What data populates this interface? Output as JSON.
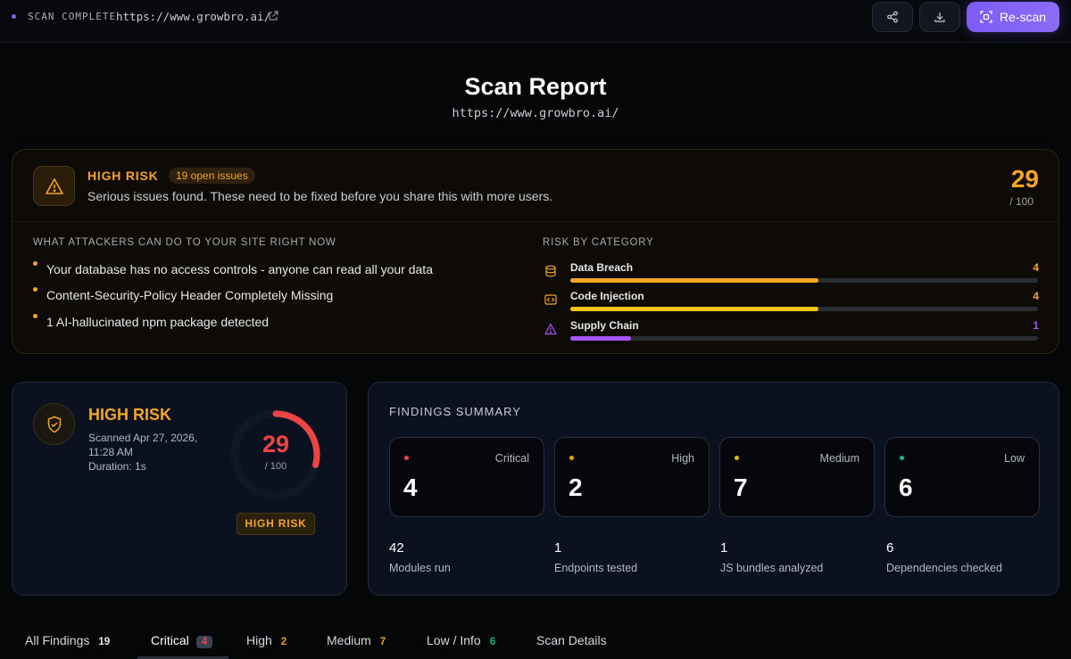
{
  "topbar": {
    "status": "SCAN COMPLETE",
    "url": "https://www.growbro.ai/",
    "share_icon": "share-icon",
    "download_icon": "download-icon",
    "rescan_label": "Re-scan",
    "accent": "#7c5cf5"
  },
  "header": {
    "title": "Scan Report",
    "url": "https://www.growbro.ai/"
  },
  "banner": {
    "risk_label": "HIGH RISK",
    "issues_pill": "19 open issues",
    "description": "Serious issues found. These need to be fixed before you share this with more users.",
    "score": "29",
    "score_max": "/ 100",
    "attackers_heading": "WHAT ATTACKERS CAN DO TO YOUR SITE RIGHT NOW",
    "attacks": [
      "Your database has no access controls - anyone can read all your data",
      "Content-Security-Policy Header Completely Missing",
      "1 AI-hallucinated npm package detected"
    ],
    "category_heading": "RISK BY CATEGORY",
    "categories": [
      {
        "label": "Data Breach",
        "count": "4",
        "fill": 0.53,
        "color": "#f5a524",
        "icon": "database-icon"
      },
      {
        "label": "Code Injection",
        "count": "4",
        "fill": 0.53,
        "color": "#f5c518",
        "icon": "code-icon"
      },
      {
        "label": "Supply Chain",
        "count": "1",
        "fill": 0.13,
        "color": "#a855f7",
        "icon": "warning-triangle-icon"
      }
    ]
  },
  "risk_card": {
    "title": "HIGH RISK",
    "scanned_line1": "Scanned Apr 27, 2026,",
    "scanned_line2": "11:28 AM",
    "duration": "Duration: 1s",
    "score": "29",
    "score_max": "/ 100",
    "score_fraction": 0.29,
    "badge": "HIGH RISK"
  },
  "findings": {
    "title": "FINDINGS SUMMARY",
    "severities": [
      {
        "label": "Critical",
        "count": "4",
        "color": "#ef4444"
      },
      {
        "label": "High",
        "count": "2",
        "color": "#f59e0b"
      },
      {
        "label": "Medium",
        "count": "7",
        "color": "#eab308"
      },
      {
        "label": "Low",
        "count": "6",
        "color": "#10b981"
      }
    ],
    "stats": [
      {
        "value": "42",
        "label": "Modules run"
      },
      {
        "value": "1",
        "label": "Endpoints tested"
      },
      {
        "value": "1",
        "label": "JS bundles analyzed"
      },
      {
        "value": "6",
        "label": "Dependencies checked"
      }
    ]
  },
  "tabs": [
    {
      "label": "All Findings",
      "count": "19",
      "color": "#e6e7ea"
    },
    {
      "label": "Critical",
      "count": "4",
      "color": "#ef4444"
    },
    {
      "label": "High",
      "count": "2",
      "color": "#f59e0b"
    },
    {
      "label": "Medium",
      "count": "7",
      "color": "#eab308"
    },
    {
      "label": "Low / Info",
      "count": "6",
      "color": "#10b981"
    },
    {
      "label": "Scan Details",
      "count": "",
      "color": "#e6e7ea"
    }
  ]
}
